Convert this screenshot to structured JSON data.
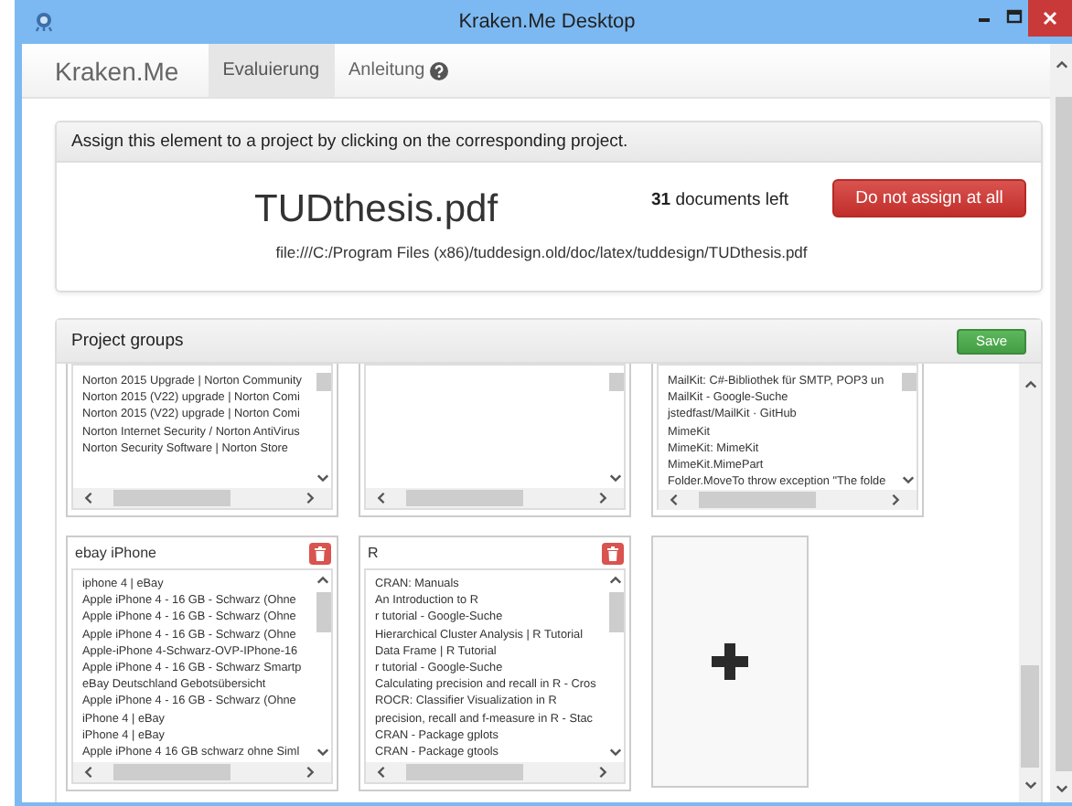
{
  "window": {
    "title": "Kraken.Me Desktop"
  },
  "navbar": {
    "brand": "Kraken.Me",
    "tabs": [
      {
        "label": "Evaluierung",
        "selected": true,
        "help": false
      },
      {
        "label": "Anleitung",
        "selected": false,
        "help": true
      }
    ]
  },
  "assign_panel": {
    "instruction": "Assign this element to a project by clicking on the corresponding project.",
    "document_title": "TUDthesis.pdf",
    "path": "file:///C:/Program Files (x86)/tuddesign.old/doc/latex/tuddesign/TUDthesis.pdf",
    "remaining": "**31** documents left",
    "skip_button": "Do not assign at all"
  },
  "project_groups": {
    "title": "Project groups",
    "save_button": "Save",
    "cards": [
      {
        "kind": "group",
        "items": [
          "Norton 2015 Upgrade | Norton Community",
          "Norton 2015 (V22) upgrade | Norton Comi",
          "Norton 2015 (V22) upgrade | Norton Comi",
          "Norton Internet Security / Norton AntiVirus",
          "Norton Security Software | Norton Store"
        ]
      },
      {
        "kind": "group"
      },
      {
        "kind": "group",
        "items": [
          "MailKit: C#-Bibliothek für SMTP, POP3 un",
          "MailKit - Google-Suche",
          "jstedfast/MailKit · GitHub",
          "MimeKit",
          "MimeKit: MimeKit",
          "MimeKit.MimePart",
          "Folder.MoveTo throw exception \"The folde"
        ]
      },
      {
        "kind": "group",
        "title": "ebay iPhone",
        "items": [
          "iphone 4 | eBay",
          "Apple iPhone 4 - 16 GB - Schwarz (Ohne",
          "Apple iPhone 4 - 16 GB - Schwarz (Ohne",
          "Apple iPhone 4 - 16 GB - Schwarz (Ohne",
          "Apple-iPhone 4-Schwarz-OVP-IPhone-16",
          "Apple iPhone 4 - 16 GB - Schwarz Smartp",
          "eBay Deutschland Gebotsübersicht",
          "Apple iPhone 4 - 16 GB - Schwarz (Ohne",
          "iPhone 4 | eBay",
          "iPhone 4 | eBay",
          "Apple iPhone 4 16 GB schwarz ohne Siml"
        ]
      },
      {
        "kind": "group",
        "title": "R",
        "items": [
          "CRAN: Manuals",
          "An Introduction to R",
          "r tutorial - Google-Suche",
          "Hierarchical Cluster Analysis | R Tutorial",
          "Data Frame | R Tutorial",
          "r tutorial - Google-Suche",
          "Calculating precision and recall in R - Cros",
          "ROCR: Classifier Visualization in R",
          "precision, recall and f-measure in R - Stac",
          "CRAN - Package gplots",
          "CRAN - Package gtools"
        ]
      },
      {
        "kind": "add"
      }
    ]
  }
}
